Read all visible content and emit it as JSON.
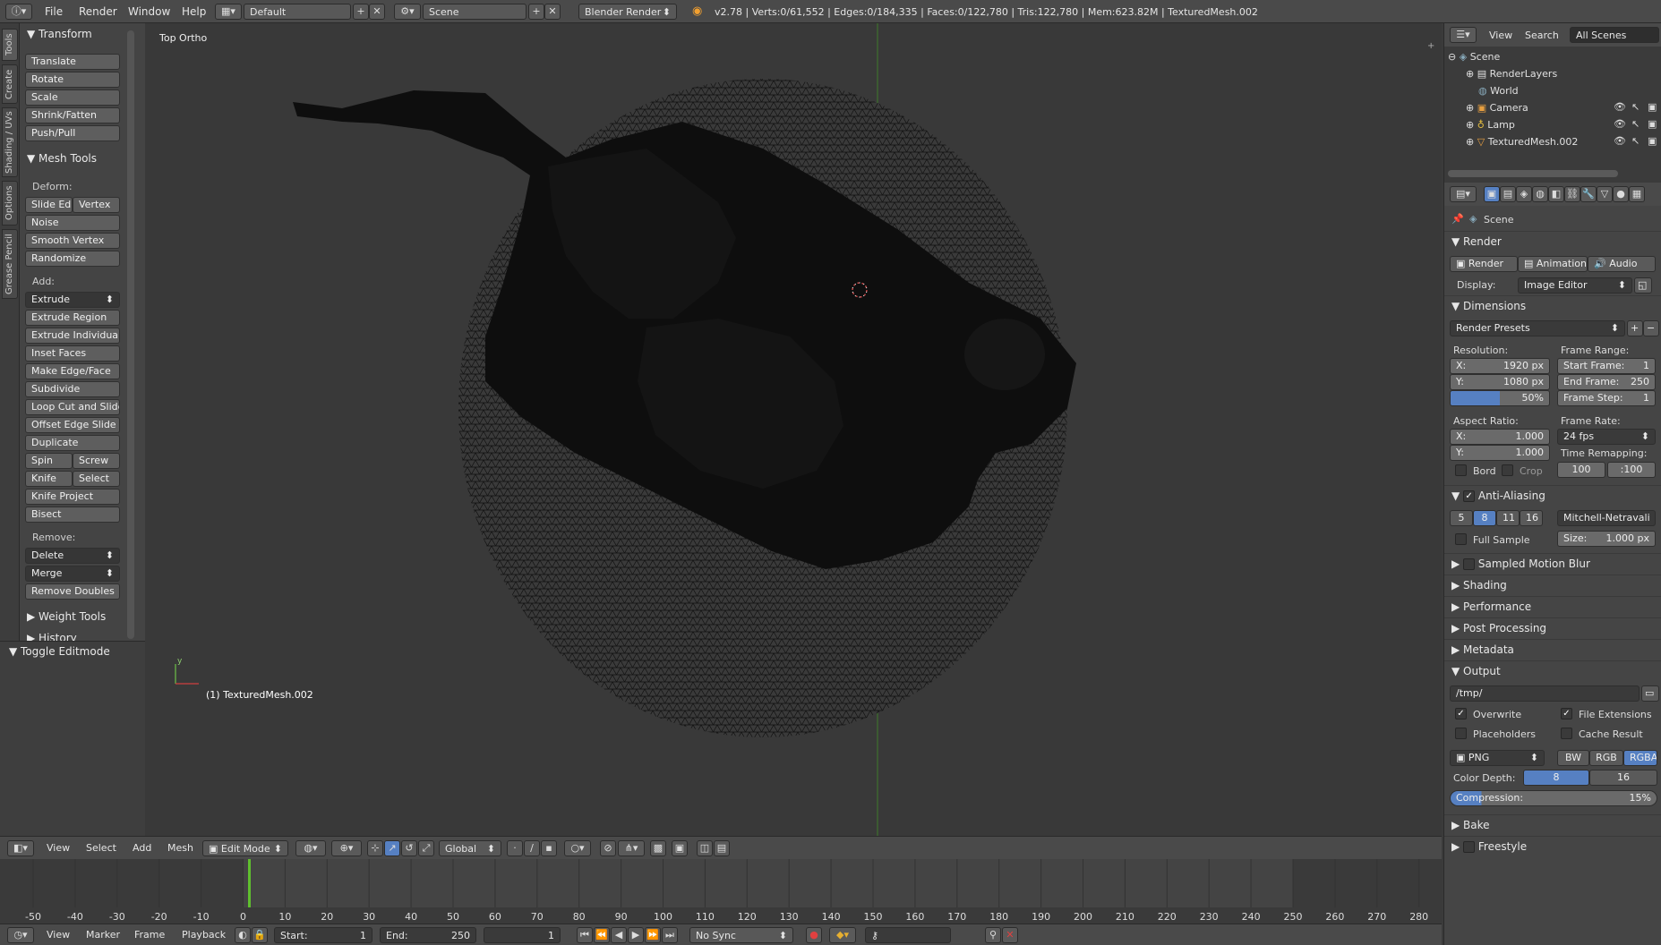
{
  "topbar": {
    "menus": [
      "File",
      "Render",
      "Window",
      "Help"
    ],
    "layout": "Default",
    "scene": "Scene",
    "engine": "Blender Render",
    "stats": "v2.78 | Verts:0/61,552 | Edges:0/184,335 | Faces:0/122,780 | Tris:122,780 | Mem:623.82M | TexturedMesh.002"
  },
  "tabs": [
    "Tools",
    "Create",
    "Shading / UVs",
    "Options",
    "Grease Pencil"
  ],
  "toolshelf": {
    "transform": {
      "title": "Transform",
      "items": [
        "Translate",
        "Rotate",
        "Scale",
        "Shrink/Fatten",
        "Push/Pull"
      ]
    },
    "mesh_tools": {
      "title": "Mesh Tools",
      "deform_label": "Deform:",
      "slide_edge": "Slide Ed",
      "vertex": "Vertex",
      "deform_items": [
        "Noise",
        "Smooth Vertex",
        "Randomize"
      ],
      "add_label": "Add:",
      "extrude": "Extrude",
      "add_items": [
        "Extrude Region",
        "Extrude Individual",
        "Inset Faces",
        "Make Edge/Face",
        "Subdivide",
        "Loop Cut and Slide",
        "Offset Edge Slide",
        "Duplicate"
      ],
      "spin": "Spin",
      "screw": "Screw",
      "knife": "Knife",
      "select": "Select",
      "knife_project": "Knife Project",
      "bisect": "Bisect",
      "remove_label": "Remove:",
      "delete": "Delete",
      "merge": "Merge",
      "remove_doubles": "Remove Doubles"
    },
    "weight_tools": "Weight Tools",
    "history": "History",
    "toggle_editmode": "Toggle Editmode"
  },
  "viewport": {
    "view_label": "Top Ortho",
    "object_label": "(1) TexturedMesh.002",
    "axis_y": "y"
  },
  "viewport_header": {
    "menus": [
      "View",
      "Select",
      "Add",
      "Mesh"
    ],
    "mode": "Edit Mode",
    "orientation": "Global"
  },
  "timeline": {
    "ticks": [
      -50,
      -40,
      -30,
      -20,
      -10,
      0,
      10,
      20,
      30,
      40,
      50,
      60,
      70,
      80,
      90,
      100,
      110,
      120,
      130,
      140,
      150,
      160,
      170,
      180,
      190,
      200,
      210,
      220,
      230,
      240,
      250,
      260,
      270,
      280
    ],
    "current_frame": 1
  },
  "timeline_header": {
    "menus": [
      "View",
      "Marker",
      "Frame",
      "Playback"
    ],
    "start": "Start:",
    "start_val": "1",
    "end": "End:",
    "end_val": "250",
    "current": "1",
    "sync": "No Sync"
  },
  "outliner": {
    "menus": [
      "View",
      "Search"
    ],
    "filter": "All Scenes",
    "rows": [
      "Scene",
      "RenderLayers",
      "World",
      "Camera",
      "Lamp",
      "TexturedMesh.002"
    ]
  },
  "properties": {
    "context": "Scene",
    "render": {
      "title": "Render",
      "btn_render": "Render",
      "btn_animation": "Animation",
      "btn_audio": "Audio",
      "display_label": "Display:",
      "display_value": "Image Editor"
    },
    "dimensions": {
      "title": "Dimensions",
      "presets": "Render Presets",
      "resolution_label": "Resolution:",
      "res_x": "X:",
      "res_x_val": "1920 px",
      "res_y": "Y:",
      "res_y_val": "1080 px",
      "res_pct": "50%",
      "frame_range_label": "Frame Range:",
      "start_frame": "Start Frame:",
      "start_frame_val": "1",
      "end_frame": "End Frame:",
      "end_frame_val": "250",
      "frame_step": "Frame Step:",
      "frame_step_val": "1",
      "aspect_label": "Aspect Ratio:",
      "asp_x": "X:",
      "asp_x_val": "1.000",
      "asp_y": "Y:",
      "asp_y_val": "1.000",
      "frame_rate_label": "Frame Rate:",
      "frame_rate": "24 fps",
      "time_remap_label": "Time Remapping:",
      "remap_old": "100",
      "remap_new": ":100",
      "bord": "Bord",
      "crop": "Crop"
    },
    "anti_aliasing": {
      "title": "Anti-Aliasing",
      "samples": [
        "5",
        "8",
        "11",
        "16"
      ],
      "filter": "Mitchell-Netravali",
      "full_sample": "Full Sample",
      "size": "Size:",
      "size_val": "1.000 px"
    },
    "collapsed_sections": [
      "Sampled Motion Blur",
      "Shading",
      "Performance",
      "Post Processing",
      "Metadata"
    ],
    "output": {
      "title": "Output",
      "path": "/tmp/",
      "overwrite": "Overwrite",
      "file_ext": "File Extensions",
      "placeholders": "Placeholders",
      "cache_result": "Cache Result",
      "format": "PNG",
      "bw": "BW",
      "rgb": "RGB",
      "rgba": "RGBA",
      "color_depth": "Color Depth:",
      "depth_8": "8",
      "depth_16": "16",
      "compression": "Compression:",
      "compression_val": "15%"
    },
    "bake": "Bake",
    "freestyle": "Freestyle"
  }
}
